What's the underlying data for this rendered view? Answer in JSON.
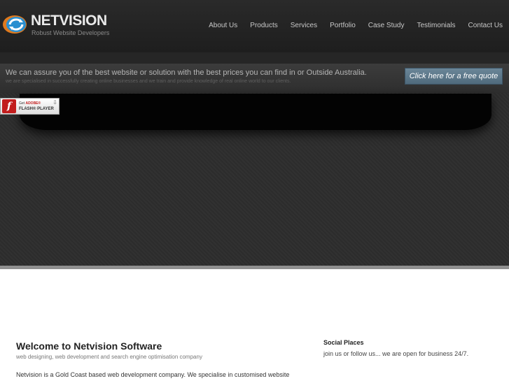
{
  "logo": {
    "title": "NETVISION",
    "tagline": "Robust Website Developers",
    "icon": "netvision-logo-icon"
  },
  "nav": {
    "items": [
      {
        "label": "About Us"
      },
      {
        "label": "Products"
      },
      {
        "label": "Services"
      },
      {
        "label": "Portfolio"
      },
      {
        "label": "Case Study"
      },
      {
        "label": "Testimonials"
      },
      {
        "label": "Contact Us"
      }
    ]
  },
  "promo": {
    "headline": "We can assure you of the best website or solution with the best prices you can find in or Outside Australia.",
    "subline": "we are specialised in successfully creating online businesses and we train and provide knowledge of real online world to our clients.",
    "cta_label": "Click here for a free quote"
  },
  "flash_badge": {
    "line1_prefix": "Get",
    "line1_brand": "ADOBE®",
    "line2": "FLASH® PLAYER",
    "icon": "flash-player-icon"
  },
  "welcome": {
    "title": "Welcome to Netvision Software",
    "subtitle": "web designing, web development and search engine optimisation company",
    "body": "Netvision is a Gold Coast based web development company. We specialise in customised website"
  },
  "social": {
    "title": "Social Places",
    "body": "join us or follow us... we are open for business 24/7."
  },
  "colors": {
    "header_bg": "#2a2a2a",
    "promo_bg": "#333333",
    "cta_bg": "#5a7587",
    "banner_bg": "#2c2c2c"
  }
}
